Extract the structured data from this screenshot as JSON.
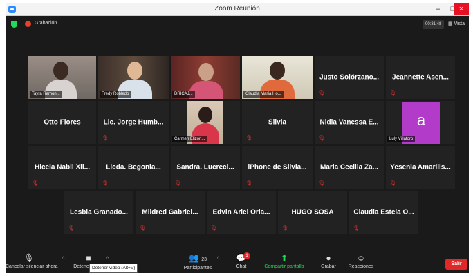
{
  "window": {
    "title": "Zoom Reunión",
    "minimize": "–",
    "maximize": "□",
    "close": "×"
  },
  "topbar": {
    "recording_label": "Grabación",
    "gallery_label": "00:31:48",
    "view_label": "Vista"
  },
  "tiles": [
    {
      "name": "Tayra Ramon...",
      "video": true
    },
    {
      "name": "Fredy Robledo",
      "video": true
    },
    {
      "name": "DRICAJ...",
      "video": true
    },
    {
      "name": "Claudia María Ho...",
      "video": true
    },
    {
      "name": "Justo Solórzano...",
      "video": false
    },
    {
      "name": "Jeannette Asen...",
      "video": false
    },
    {
      "name": "Otto Flores",
      "video": false
    },
    {
      "name": "Lic. Jorge Humb...",
      "video": false
    },
    {
      "name": "Carmen Elizon...",
      "video": true
    },
    {
      "name": "Silvia",
      "video": false
    },
    {
      "name": "Nidia Vanessa E...",
      "video": false
    },
    {
      "name": "Luly Villatoro",
      "video": false,
      "avatar": "a"
    },
    {
      "name": "Hicela Nabil Xil...",
      "video": false
    },
    {
      "name": "Licda. Begonia...",
      "video": false
    },
    {
      "name": "Sandra. Lucreci...",
      "video": false
    },
    {
      "name": "iPhone de Silvia...",
      "video": false
    },
    {
      "name": "Maria Cecilia Za...",
      "video": false
    },
    {
      "name": "Yesenia Amarilis...",
      "video": false
    },
    {
      "name": "Lesbia Granado...",
      "video": false
    },
    {
      "name": "Mildred Gabriel...",
      "video": false
    },
    {
      "name": "Edvin Ariel Orla...",
      "video": false
    },
    {
      "name": "HUGO SOSA",
      "video": false
    },
    {
      "name": "Claudia Estela O...",
      "video": false
    }
  ],
  "toolbar": {
    "mute": "Cancelar silenciar ahora",
    "video": "Detener video",
    "participants": "Participantes",
    "participants_count": "23",
    "chat": "Chat",
    "chat_badge": "1",
    "share": "Compartir pantalla",
    "record": "Grabar",
    "reactions": "Reacciones",
    "leave": "Salir",
    "tooltip": "Detener video (Alt+V)"
  },
  "colors": {
    "accent_active": "#c7e91f",
    "leave": "#e02828",
    "share": "#23d959",
    "avatar": "#b23bc9"
  }
}
